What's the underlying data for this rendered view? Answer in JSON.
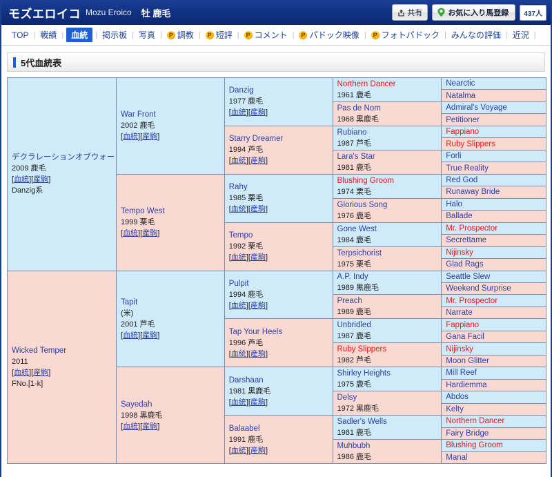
{
  "header": {
    "horse_name_ja": "モズエロイコ",
    "horse_name_en": "Mozu Eroico",
    "sex_coat": "牡 鹿毛",
    "share_label": "共有",
    "favorite_label": "お気に入り馬登録",
    "favorite_count": "437人"
  },
  "nav": {
    "items": [
      {
        "label": "TOP",
        "active": false,
        "badge": ""
      },
      {
        "label": "戦績",
        "active": false,
        "badge": ""
      },
      {
        "label": "血統",
        "active": true,
        "badge": ""
      },
      {
        "label": "掲示板",
        "active": false,
        "badge": ""
      },
      {
        "label": "写真",
        "active": false,
        "badge": ""
      },
      {
        "label": "調教",
        "active": false,
        "badge": "P"
      },
      {
        "label": "短評",
        "active": false,
        "badge": "P"
      },
      {
        "label": "コメント",
        "active": false,
        "badge": "P"
      },
      {
        "label": "パドック映像",
        "active": false,
        "badge": "P"
      },
      {
        "label": "フォトパドック",
        "active": false,
        "badge": "P"
      },
      {
        "label": "みんなの評価",
        "active": false,
        "badge": ""
      },
      {
        "label": "近況",
        "active": false,
        "badge": ""
      }
    ]
  },
  "section": {
    "title": "5代血統表"
  },
  "links": {
    "blood": "血統",
    "offspring": "産駒"
  },
  "colors": {
    "sire_blue": "#cfeaf9",
    "dam_pink": "#fbd9d3",
    "name_blue": "#2a3fa8",
    "inbred_red": "#f01414",
    "accent": "#1f5fd0"
  },
  "pedigree": {
    "gen1": [
      {
        "name": "デクラレーションオブウォー",
        "meta": "2009 鹿毛",
        "extra": "Danzig系",
        "links": true,
        "red": false,
        "side": "m"
      },
      {
        "name": "Wicked Temper",
        "meta": "2011",
        "extra": "FNo.[1-k]",
        "links": true,
        "red": false,
        "side": "f"
      }
    ],
    "gen2": [
      {
        "name": "War Front",
        "meta": "2002 鹿毛",
        "extra": "",
        "links": true,
        "red": false,
        "side": "m"
      },
      {
        "name": "Tempo West",
        "meta": "1999 栗毛",
        "extra": "",
        "links": true,
        "red": false,
        "side": "f"
      },
      {
        "name": "Tapit",
        "meta": "2001 芦毛",
        "extra": "(米)",
        "pre": true,
        "links": true,
        "red": false,
        "side": "m"
      },
      {
        "name": "Sayedah",
        "meta": "1998 黒鹿毛",
        "extra": "",
        "links": true,
        "red": false,
        "side": "f"
      }
    ],
    "gen3": [
      {
        "name": "Danzig",
        "meta": "1977 鹿毛",
        "links": true,
        "red": false,
        "side": "m"
      },
      {
        "name": "Starry Dreamer",
        "meta": "1994 芦毛",
        "links": true,
        "red": false,
        "side": "f"
      },
      {
        "name": "Rahy",
        "meta": "1985 栗毛",
        "links": true,
        "red": false,
        "side": "m"
      },
      {
        "name": "Tempo",
        "meta": "1992 栗毛",
        "links": true,
        "red": false,
        "side": "f"
      },
      {
        "name": "Pulpit",
        "meta": "1994 鹿毛",
        "links": true,
        "red": false,
        "side": "m"
      },
      {
        "name": "Tap Your Heels",
        "meta": "1996 芦毛",
        "links": true,
        "red": false,
        "side": "f"
      },
      {
        "name": "Darshaan",
        "meta": "1981 黒鹿毛",
        "links": true,
        "red": false,
        "side": "m"
      },
      {
        "name": "Balaabel",
        "meta": "1991 鹿毛",
        "links": true,
        "red": false,
        "side": "f"
      }
    ],
    "gen4": [
      {
        "name": "Northern Dancer",
        "meta": "1961 鹿毛",
        "red": true,
        "side": "m"
      },
      {
        "name": "Pas de Nom",
        "meta": "1968 黒鹿毛",
        "red": false,
        "side": "f"
      },
      {
        "name": "Rubiano",
        "meta": "1987 芦毛",
        "red": false,
        "side": "m"
      },
      {
        "name": "Lara's Star",
        "meta": "1981 鹿毛",
        "red": false,
        "side": "f"
      },
      {
        "name": "Blushing Groom",
        "meta": "1974 栗毛",
        "red": true,
        "side": "m"
      },
      {
        "name": "Glorious Song",
        "meta": "1976 鹿毛",
        "red": false,
        "side": "f"
      },
      {
        "name": "Gone West",
        "meta": "1984 鹿毛",
        "red": false,
        "side": "m"
      },
      {
        "name": "Terpsichorist",
        "meta": "1975 栗毛",
        "red": false,
        "side": "f"
      },
      {
        "name": "A.P. Indy",
        "meta": "1989 黒鹿毛",
        "red": false,
        "side": "m"
      },
      {
        "name": "Preach",
        "meta": "1989 鹿毛",
        "red": false,
        "side": "f"
      },
      {
        "name": "Unbridled",
        "meta": "1987 鹿毛",
        "red": false,
        "side": "m"
      },
      {
        "name": "Ruby Slippers",
        "meta": "1982 芦毛",
        "red": true,
        "side": "f"
      },
      {
        "name": "Shirley Heights",
        "meta": "1975 鹿毛",
        "red": false,
        "side": "m"
      },
      {
        "name": "Delsy",
        "meta": "1972 黒鹿毛",
        "red": false,
        "side": "f"
      },
      {
        "name": "Sadler's Wells",
        "meta": "1981 鹿毛",
        "red": false,
        "side": "m"
      },
      {
        "name": "Muhbubh",
        "meta": "1986 鹿毛",
        "red": false,
        "side": "f"
      }
    ],
    "gen5": [
      {
        "name": "Nearctic",
        "red": false,
        "side": "m"
      },
      {
        "name": "Natalma",
        "red": false,
        "side": "f"
      },
      {
        "name": "Admiral's Voyage",
        "red": false,
        "side": "m"
      },
      {
        "name": "Petitioner",
        "red": false,
        "side": "f"
      },
      {
        "name": "Fappiano",
        "red": true,
        "side": "m"
      },
      {
        "name": "Ruby Slippers",
        "red": true,
        "side": "f"
      },
      {
        "name": "Forli",
        "red": false,
        "side": "m"
      },
      {
        "name": "True Reality",
        "red": false,
        "side": "f"
      },
      {
        "name": "Red God",
        "red": false,
        "side": "m"
      },
      {
        "name": "Runaway Bride",
        "red": false,
        "side": "f"
      },
      {
        "name": "Halo",
        "red": false,
        "side": "m"
      },
      {
        "name": "Ballade",
        "red": false,
        "side": "f"
      },
      {
        "name": "Mr. Prospector",
        "red": true,
        "side": "m"
      },
      {
        "name": "Secrettame",
        "red": false,
        "side": "f"
      },
      {
        "name": "Nijinsky",
        "red": true,
        "side": "m"
      },
      {
        "name": "Glad Rags",
        "red": false,
        "side": "f"
      },
      {
        "name": "Seattle Slew",
        "red": false,
        "side": "m"
      },
      {
        "name": "Weekend Surprise",
        "red": false,
        "side": "f"
      },
      {
        "name": "Mr. Prospector",
        "red": true,
        "side": "m"
      },
      {
        "name": "Narrate",
        "red": false,
        "side": "f"
      },
      {
        "name": "Fappiano",
        "red": true,
        "side": "m"
      },
      {
        "name": "Gana Facil",
        "red": false,
        "side": "f"
      },
      {
        "name": "Nijinsky",
        "red": true,
        "side": "m"
      },
      {
        "name": "Moon Glitter",
        "red": false,
        "side": "f"
      },
      {
        "name": "Mill Reef",
        "red": false,
        "side": "m"
      },
      {
        "name": "Hardiemma",
        "red": false,
        "side": "f"
      },
      {
        "name": "Abdos",
        "red": false,
        "side": "m"
      },
      {
        "name": "Kelty",
        "red": false,
        "side": "f"
      },
      {
        "name": "Northern Dancer",
        "red": true,
        "side": "m"
      },
      {
        "name": "Fairy Bridge",
        "red": false,
        "side": "f"
      },
      {
        "name": "Blushing Groom",
        "red": true,
        "side": "m"
      },
      {
        "name": "Manal",
        "red": false,
        "side": "f"
      }
    ]
  }
}
